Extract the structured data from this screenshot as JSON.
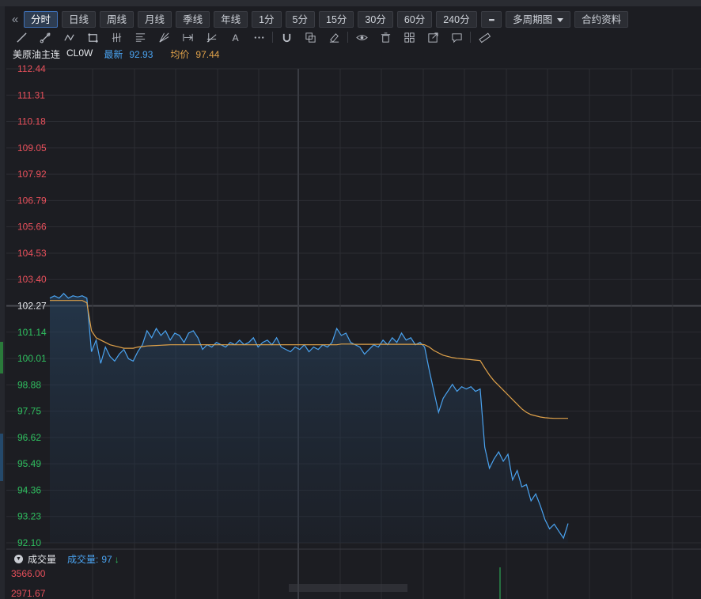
{
  "periods": [
    {
      "label": "分时",
      "active": true
    },
    {
      "label": "日线"
    },
    {
      "label": "周线"
    },
    {
      "label": "月线"
    },
    {
      "label": "季线"
    },
    {
      "label": "年线"
    },
    {
      "label": "1分"
    },
    {
      "label": "5分"
    },
    {
      "label": "15分"
    },
    {
      "label": "30分"
    },
    {
      "label": "60分"
    },
    {
      "label": "240分"
    }
  ],
  "more_label": "▪▪▪",
  "multi_period_label": "多周期图",
  "contract_info_label": "合约资料",
  "tools": [
    "line-icon",
    "ray-icon",
    "polyline-icon",
    "rect-icon",
    "parallel-icon",
    "fib-icon",
    "fan-icon",
    "measure-icon",
    "gann-icon",
    "text-icon",
    "more-dots-icon",
    "magnet-icon",
    "copy-icon",
    "eraser-icon",
    "eye-icon",
    "trash-icon",
    "layout-icon",
    "export-icon",
    "comment-icon",
    "ruler-icon"
  ],
  "info": {
    "name": "美原油主连",
    "code": "CL0W",
    "latest_label": "最新",
    "latest": "92.93",
    "avg_label": "均价",
    "avg": "97.44"
  },
  "chart_data": {
    "type": "line",
    "ylim": [
      92.1,
      112.44
    ],
    "ticks": [
      "112.44",
      "111.31",
      "110.18",
      "109.05",
      "107.92",
      "106.79",
      "105.66",
      "104.53",
      "103.40",
      "102.27",
      "101.14",
      "100.01",
      "98.88",
      "97.75",
      "96.62",
      "95.49",
      "94.36",
      "93.23",
      "92.10"
    ],
    "prev_close": 102.27,
    "series": [
      {
        "values": [
          102.6,
          102.7,
          102.6,
          102.8,
          102.6,
          102.7,
          102.65,
          102.7,
          102.6,
          100.3,
          100.8,
          99.8,
          100.5,
          100.1,
          99.9,
          100.2,
          100.4,
          100.0,
          99.9,
          100.3,
          100.6,
          101.2,
          100.9,
          101.3,
          101.0,
          101.2,
          100.8,
          101.1,
          101.0,
          100.7,
          101.1,
          101.2,
          100.9,
          100.4,
          100.6,
          100.5,
          100.7,
          100.6,
          100.5,
          100.7,
          100.6,
          100.8,
          100.6,
          100.7,
          100.9,
          100.5,
          100.7,
          100.8,
          100.6,
          100.9,
          100.5,
          100.4,
          100.3,
          100.5,
          100.4,
          100.6,
          100.3,
          100.5,
          100.4,
          100.6,
          100.5,
          100.7,
          101.3,
          101.0,
          101.1,
          100.7,
          100.6,
          100.5,
          100.2,
          100.4,
          100.6,
          100.5,
          100.8,
          100.6,
          100.9,
          100.7,
          101.1,
          100.8,
          100.9,
          100.6,
          100.7,
          100.5,
          99.5,
          98.6,
          97.7,
          98.3,
          98.6,
          98.9,
          98.6,
          98.8,
          98.7,
          98.8,
          98.6,
          98.7,
          96.2,
          95.3,
          95.7,
          96.0,
          95.6,
          95.9,
          94.8,
          95.2,
          94.5,
          94.6,
          93.9,
          94.2,
          93.7,
          93.1,
          92.7,
          92.9,
          92.6,
          92.3,
          92.93
        ]
      },
      {
        "values": [
          102.5,
          102.5,
          102.5,
          102.5,
          102.5,
          102.5,
          102.5,
          102.5,
          102.4,
          101.2,
          100.9,
          100.8,
          100.7,
          100.6,
          100.55,
          100.5,
          100.45,
          100.45,
          100.45,
          100.5,
          100.52,
          100.55,
          100.56,
          100.57,
          100.58,
          100.59,
          100.6,
          100.6,
          100.6,
          100.6,
          100.6,
          100.6,
          100.6,
          100.6,
          100.6,
          100.6,
          100.6,
          100.6,
          100.6,
          100.6,
          100.6,
          100.6,
          100.6,
          100.6,
          100.6,
          100.6,
          100.6,
          100.6,
          100.6,
          100.6,
          100.6,
          100.6,
          100.6,
          100.6,
          100.6,
          100.6,
          100.6,
          100.6,
          100.6,
          100.6,
          100.6,
          100.6,
          100.6,
          100.63,
          100.63,
          100.63,
          100.62,
          100.62,
          100.62,
          100.62,
          100.62,
          100.62,
          100.62,
          100.62,
          100.62,
          100.62,
          100.62,
          100.62,
          100.62,
          100.62,
          100.62,
          100.6,
          100.5,
          100.35,
          100.25,
          100.15,
          100.1,
          100.05,
          100.02,
          100.0,
          99.98,
          99.96,
          99.94,
          99.92,
          99.6,
          99.3,
          99.05,
          98.85,
          98.65,
          98.45,
          98.25,
          98.05,
          97.85,
          97.7,
          97.6,
          97.55,
          97.5,
          97.47,
          97.45,
          97.44,
          97.44,
          97.44,
          97.44
        ]
      }
    ]
  },
  "volume": {
    "label": "成交量",
    "vol_label": "成交量:",
    "vol_value": "97",
    "arrow": "↓",
    "ticks": [
      "3566.00",
      "2971.67"
    ]
  }
}
